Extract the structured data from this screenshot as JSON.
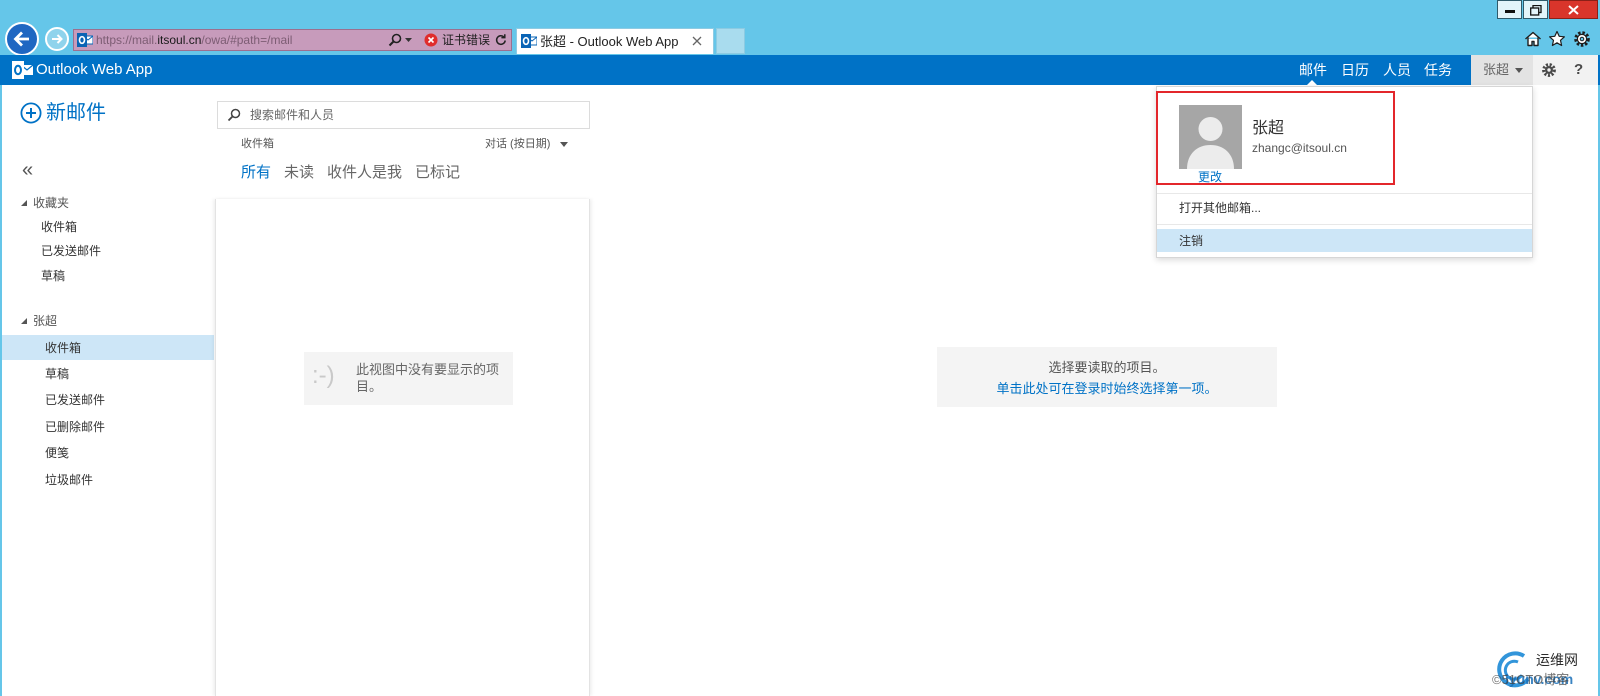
{
  "colors": {
    "accent": "#0072c6",
    "browser_frame": "#65c6e9",
    "address_bar_cert_error": "#c79bbb",
    "selected_row": "#cde6f7",
    "annotation_box": "#e3262b",
    "close_button": "#d9352b"
  },
  "browser": {
    "window_controls": [
      "minimize-icon",
      "restore-icon",
      "close-icon"
    ],
    "nav_icons": [
      "back-arrow-icon",
      "forward-arrow-icon"
    ],
    "address": {
      "site_icon": "outlook-icon",
      "prefix": "https://mail.",
      "host": "itsoul.cn",
      "path": "/owa/#path=/mail",
      "cert_error": "证书错误"
    },
    "tabs": [
      {
        "title": "张超 - Outlook Web App",
        "icon": "outlook-icon",
        "active": true
      }
    ],
    "toolbar_icons": [
      "home-icon",
      "favorites-star-icon",
      "tools-gear-icon"
    ]
  },
  "header": {
    "app_title": "Outlook Web App",
    "nav": [
      {
        "label": "邮件",
        "active": true
      },
      {
        "label": "日历"
      },
      {
        "label": "人员"
      },
      {
        "label": "任务"
      }
    ],
    "user_name": "张超",
    "help_glyph": "?"
  },
  "left_nav": {
    "new_mail": "新邮件",
    "collapse_glyph": "«",
    "favorites": {
      "title": "收藏夹",
      "items": [
        {
          "label": "收件箱"
        },
        {
          "label": "已发送邮件"
        },
        {
          "label": "草稿"
        }
      ]
    },
    "mailbox": {
      "title": "张超",
      "items": [
        {
          "label": "收件箱",
          "selected": true
        },
        {
          "label": "草稿"
        },
        {
          "label": "已发送邮件"
        },
        {
          "label": "已删除邮件"
        },
        {
          "label": "便笺"
        },
        {
          "label": "垃圾邮件"
        }
      ]
    }
  },
  "message_list": {
    "search_placeholder": "搜索邮件和人员",
    "folder": "收件箱",
    "sort": "对话 (按日期)",
    "filters": [
      {
        "label": "所有",
        "active": true
      },
      {
        "label": "未读"
      },
      {
        "label": "收件人是我"
      },
      {
        "label": "已标记"
      }
    ],
    "empty_face": ":-)",
    "empty_text": "此视图中没有要显示的项目。"
  },
  "reading_pane": {
    "prompt": "选择要读取的项目。",
    "link": "单击此处可在登录时始终选择第一项。"
  },
  "user_menu": {
    "name": "张超",
    "email": "zhangc@itsoul.cn",
    "change_photo": "更改",
    "open_other_mailbox": "打开其他邮箱...",
    "sign_out": "注销",
    "sign_out_hovered": true
  },
  "watermark": {
    "site_name": "运维网",
    "site_url": "iyunv.com",
    "blog": "©51CTO博客"
  }
}
